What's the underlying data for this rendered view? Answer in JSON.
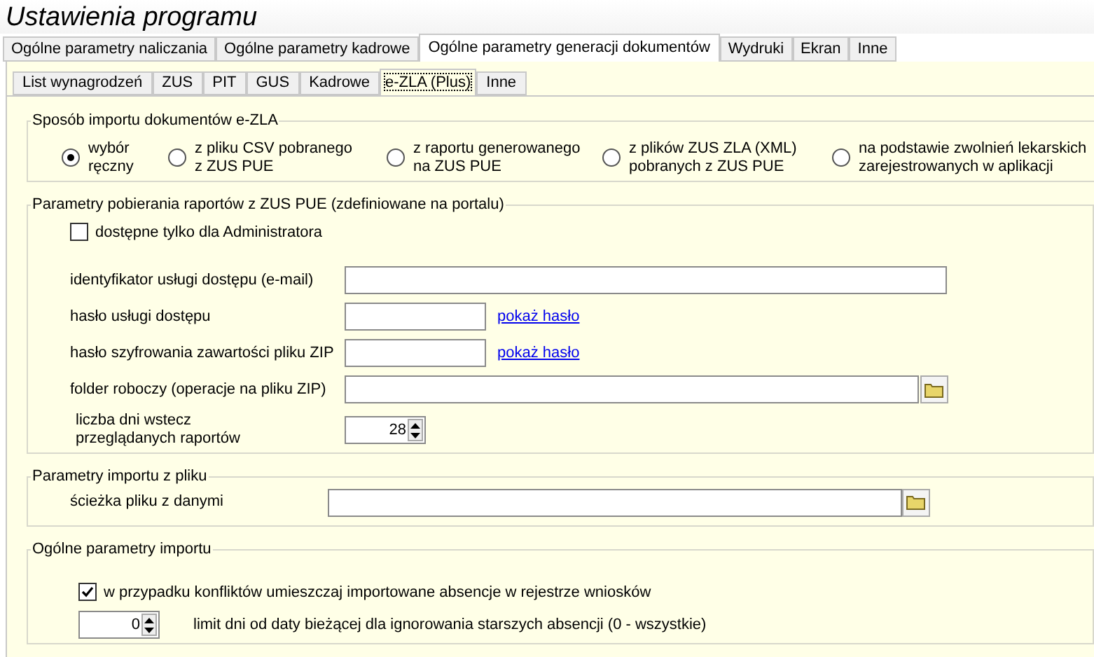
{
  "window": {
    "title": "Ustawienia programu"
  },
  "tabs": [
    {
      "label": "Ogólne parametry naliczania",
      "selected": false
    },
    {
      "label": "Ogólne parametry kadrowe",
      "selected": false
    },
    {
      "label": "Ogólne parametry generacji dokumentów",
      "selected": true
    },
    {
      "label": "Wydruki",
      "selected": false
    },
    {
      "label": "Ekran",
      "selected": false
    },
    {
      "label": "Inne",
      "selected": false
    }
  ],
  "subtabs": [
    {
      "label": "List wynagrodzeń",
      "selected": false
    },
    {
      "label": "ZUS",
      "selected": false
    },
    {
      "label": "PIT",
      "selected": false
    },
    {
      "label": "GUS",
      "selected": false
    },
    {
      "label": "Kadrowe",
      "selected": false
    },
    {
      "label": "e-ZLA (Plus)",
      "selected": true
    },
    {
      "label": "Inne",
      "selected": false
    }
  ],
  "import_method": {
    "title": "Sposób importu dokumentów e-ZLA",
    "options": [
      {
        "label": "wybór\nręczny",
        "selected": true
      },
      {
        "label": "z pliku CSV pobranego\nz ZUS PUE",
        "selected": false
      },
      {
        "label": "z raportu generowanego\nna ZUS PUE",
        "selected": false
      },
      {
        "label": "z plików ZUS ZLA (XML)\npobranych z ZUS PUE",
        "selected": false
      },
      {
        "label": "na podstawie zwolnień lekarskich\nzarejestrowanych w aplikacji",
        "selected": false
      }
    ]
  },
  "report_params": {
    "title": "Parametry pobierania raportów z ZUS PUE (zdefiniowane na portalu)",
    "admin_only": {
      "label": "dostępne tylko dla Administratora",
      "checked": false
    },
    "fields": [
      {
        "kind": "text",
        "label": "identyfikator usługi dostępu (e-mail)"
      },
      {
        "kind": "password",
        "label": "hasło usługi dostępu",
        "link": "pokaż hasło"
      },
      {
        "kind": "password",
        "label": "hasło szyfrowania zawartości pliku ZIP",
        "link": "pokaż hasło"
      },
      {
        "kind": "folder",
        "label": "folder roboczy (operacje na pliku ZIP)"
      },
      {
        "kind": "spinner",
        "label": "liczba dni wstecz\nprzeglądanych raportów",
        "value": "28"
      }
    ]
  },
  "file_import": {
    "title": "Parametry importu z pliku",
    "path_label": "ścieżka pliku z danymi"
  },
  "general_import": {
    "title": "Ogólne parametry importu",
    "conflicts": {
      "label": "w przypadku konfliktów umieszczaj importowane absencje w rejestrze wniosków",
      "checked": true
    },
    "limit": {
      "value": "0",
      "label": "limit dni od daty bieżącej dla ignorowania starszych absencji (0 - wszystkie)"
    }
  }
}
